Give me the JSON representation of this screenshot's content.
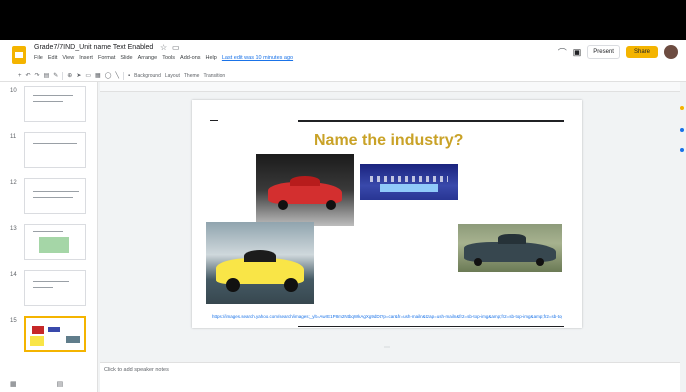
{
  "header": {
    "doc_title": "Grade7/7IND_Unit name Text Enabled",
    "star_icon": "star-icon",
    "folder_icon": "folder-icon",
    "menu": [
      "File",
      "Edit",
      "View",
      "Insert",
      "Format",
      "Slide",
      "Arrange",
      "Tools",
      "Add-ons",
      "Help"
    ],
    "last_edit": "Last edit was 10 minutes ago",
    "present_label": "Present",
    "share_label": "Share"
  },
  "toolbar": {
    "background_label": "Background",
    "layout_label": "Layout",
    "theme_label": "Theme",
    "transition_label": "Transition"
  },
  "filmstrip": {
    "slides": [
      {
        "num": "10"
      },
      {
        "num": "11"
      },
      {
        "num": "12"
      },
      {
        "num": "13"
      },
      {
        "num": "14"
      },
      {
        "num": "15"
      }
    ],
    "grid_view_icon": "grid-view-icon",
    "filmstrip_view_icon": "filmstrip-view-icon"
  },
  "slide": {
    "title": "Name the industry?",
    "link": "https://images.search.yahoo.com/search/images;_ylt=AwrE1P8m2NtbqWkAgXg9dDt?p=car&fr=ush-mailn&tzap=ush-mailn&fr2=sb-top-img&amp;fr2=sb-top-img&amp;fr2=sb-top-img&amp;fr2=sb-top-img"
  },
  "notes": {
    "placeholder": "Click to add speaker notes"
  },
  "colors": {
    "accent": "#f4b400",
    "title": "#c9a227",
    "link": "#1a73e8"
  }
}
